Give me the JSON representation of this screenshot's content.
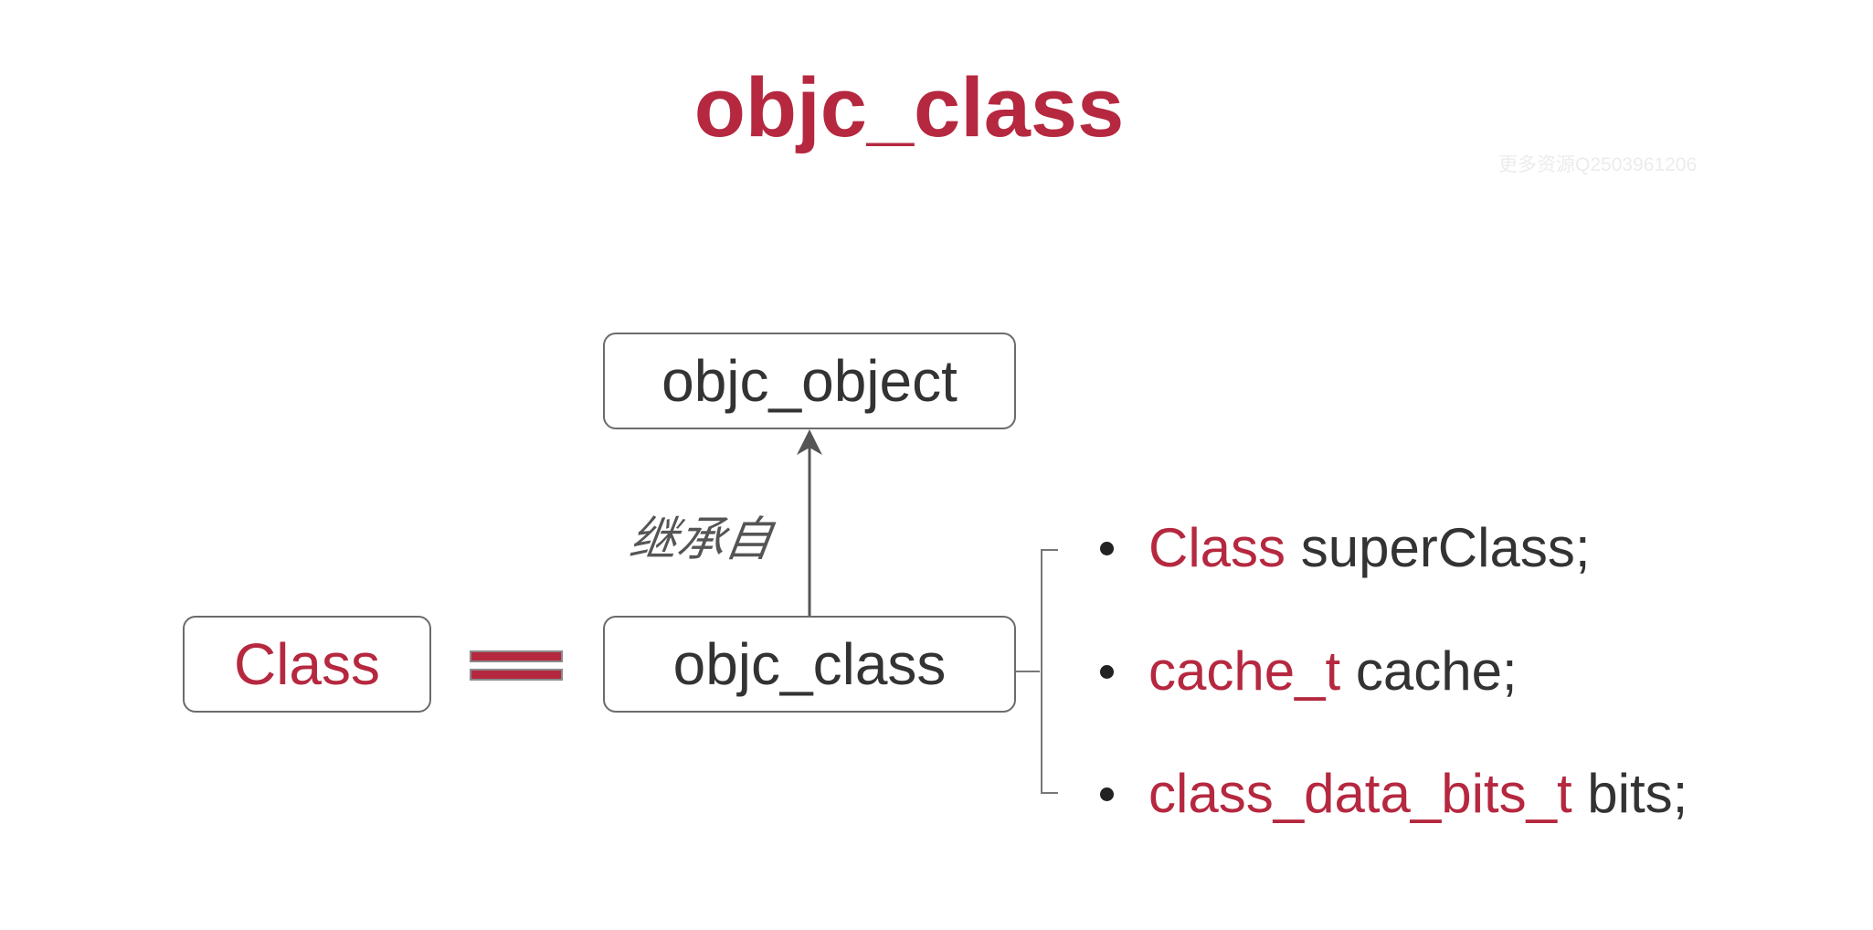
{
  "title": "objc_class",
  "watermark": "更多资源Q2503961206",
  "diagram": {
    "parent_box": "objc_object",
    "child_box": "objc_class",
    "alias_box": "Class",
    "inherit_label": "继承自",
    "equals_icon": "double-bar-equals-icon",
    "members": [
      {
        "type": "Class",
        "rest": " superClass;"
      },
      {
        "type": "cache_t",
        "rest": " cache;"
      },
      {
        "type": "class_data_bits_t",
        "rest": " bits;"
      }
    ]
  },
  "colors": {
    "accent": "#b5283f",
    "text": "#333333",
    "border": "#6b6b6b"
  }
}
